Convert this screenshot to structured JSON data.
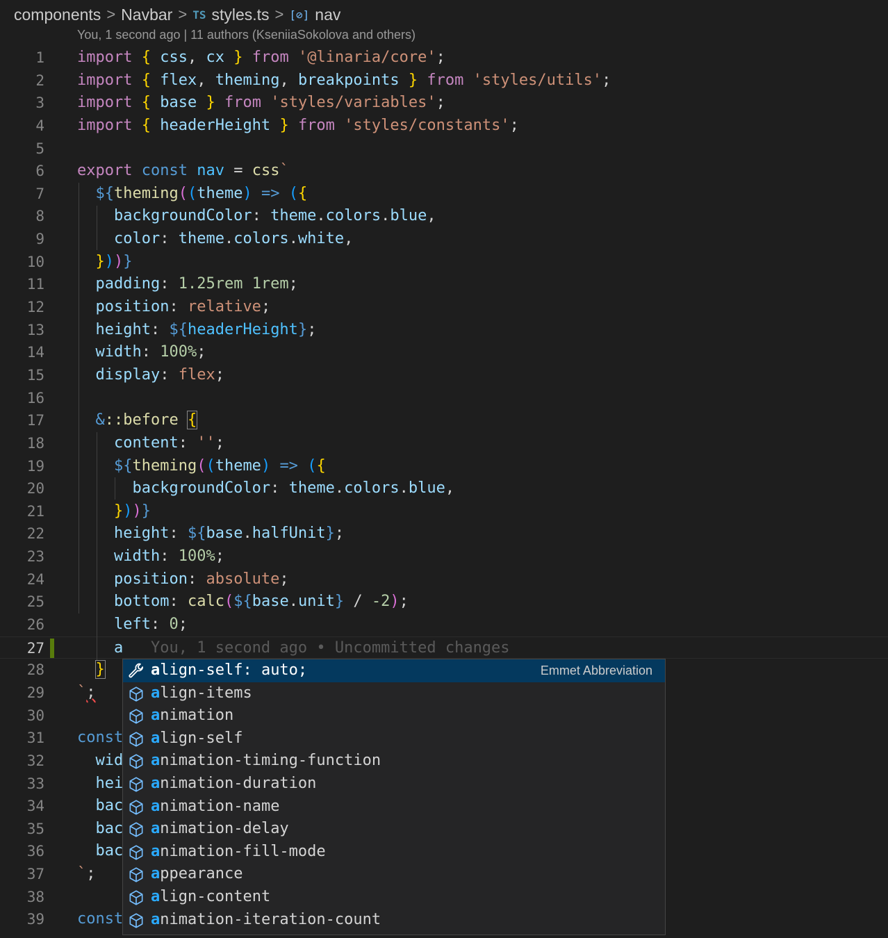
{
  "breadcrumb": {
    "items": [
      "components",
      "Navbar",
      "styles.ts",
      "nav"
    ],
    "ts_badge": "TS",
    "symbol_badge": "[⊘]",
    "separator": ">"
  },
  "codelens": "You, 1 second ago | 11 authors (KseniiaSokolova and others)",
  "editor": {
    "line_numbers": [
      "1",
      "2",
      "3",
      "4",
      "5",
      "6",
      "7",
      "8",
      "9",
      "10",
      "11",
      "12",
      "13",
      "14",
      "15",
      "16",
      "17",
      "18",
      "19",
      "20",
      "21",
      "22",
      "23",
      "24",
      "25",
      "26",
      "27",
      "28",
      "29",
      "30",
      "31",
      "32",
      "33",
      "34",
      "35",
      "36",
      "37",
      "38",
      "39"
    ],
    "active_line": 27,
    "inline_blame": "You, 1 second ago • Uncommitted changes",
    "typed_text": "a"
  },
  "suggest_widget": {
    "items": [
      {
        "match": "a",
        "rest": "lign-self: auto;",
        "kind": "emmet",
        "detail": "Emmet Abbreviation"
      },
      {
        "match": "a",
        "rest": "lign-items",
        "kind": "property"
      },
      {
        "match": "a",
        "rest": "nimation",
        "kind": "property"
      },
      {
        "match": "a",
        "rest": "lign-self",
        "kind": "property"
      },
      {
        "match": "a",
        "rest": "nimation-timing-function",
        "kind": "property"
      },
      {
        "match": "a",
        "rest": "nimation-duration",
        "kind": "property"
      },
      {
        "match": "a",
        "rest": "nimation-name",
        "kind": "property"
      },
      {
        "match": "a",
        "rest": "nimation-delay",
        "kind": "property"
      },
      {
        "match": "a",
        "rest": "nimation-fill-mode",
        "kind": "property"
      },
      {
        "match": "a",
        "rest": "ppearance",
        "kind": "property"
      },
      {
        "match": "a",
        "rest": "lign-content",
        "kind": "property"
      },
      {
        "match": "a",
        "rest": "nimation-iteration-count",
        "kind": "property"
      }
    ]
  },
  "colors": {
    "background": "#1e1e1e",
    "keyword": "#c586c0",
    "storage": "#569cd6",
    "string": "#ce9178",
    "function": "#dcdcaa",
    "selection": "#04395e",
    "match_highlight": "#2aaaff",
    "modified_gutter": "#587c0c"
  }
}
